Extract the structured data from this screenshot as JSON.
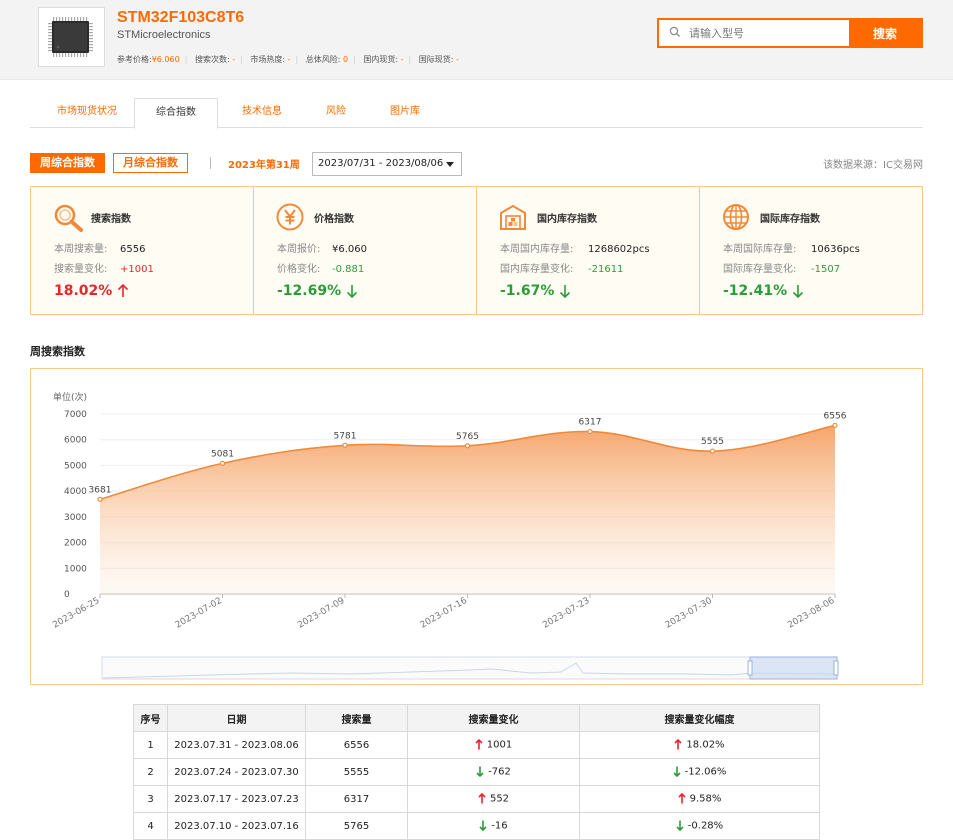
{
  "header": {
    "part_number": "STM32F103C8T6",
    "manufacturer": "STMicroelectronics",
    "metrics": [
      {
        "label": "参考价格:",
        "value": "¥6.060"
      },
      {
        "label": "搜索次数:",
        "value": "-"
      },
      {
        "label": "市场热度:",
        "value": "-"
      },
      {
        "label": "总体风险:",
        "value": "0"
      },
      {
        "label": "国内现货:",
        "value": "-"
      },
      {
        "label": "国际现货:",
        "value": "-"
      }
    ],
    "search_placeholder": "请输入型号",
    "search_button": "搜索"
  },
  "tabs": [
    {
      "label": "市场现货状况",
      "active": false
    },
    {
      "label": "综合指数",
      "active": true
    },
    {
      "label": "技术信息",
      "active": false
    },
    {
      "label": "风险",
      "active": false
    },
    {
      "label": "图片库",
      "active": false
    }
  ],
  "period": {
    "week_button": "周综合指数",
    "month_button": "月综合指数",
    "week_label": "2023年第31周",
    "date_range": "2023/07/31 - 2023/08/06",
    "source": "该数据来源：IC交易网"
  },
  "cards": [
    {
      "icon": "magnifier-icon",
      "title": "搜索指数",
      "row1_label": "本周搜索量:",
      "row1_value": "6556",
      "row2_label": "搜索量变化:",
      "row2_value": "+1001",
      "row2_dir": "up",
      "pct": "18.02%",
      "dir": "up"
    },
    {
      "icon": "yen-icon",
      "title": "价格指数",
      "row1_label": "本周报价:",
      "row1_value": "¥6.060",
      "row2_label": "价格变化:",
      "row2_value": "-0.881",
      "row2_dir": "down",
      "pct": "-12.69%",
      "dir": "down"
    },
    {
      "icon": "warehouse-icon",
      "title": "国内库存指数",
      "row1_label": "本周国内库存量:",
      "row1_value": "1268602pcs",
      "row2_label": "国内库存量变化:",
      "row2_value": "-21611",
      "row2_dir": "down",
      "pct": "-1.67%",
      "dir": "down"
    },
    {
      "icon": "globe-icon",
      "title": "国际库存指数",
      "row1_label": "本周国际库存量:",
      "row1_value": "10636pcs",
      "row2_label": "国际库存量变化:",
      "row2_value": "-1507",
      "row2_dir": "down",
      "pct": "-12.41%",
      "dir": "down"
    }
  ],
  "chart_section_title": "周搜索指数",
  "chart_data": {
    "type": "area",
    "title": "",
    "ylabel": "单位(次)",
    "xlabel": "",
    "x": [
      "2023-06-25",
      "2023-07-02",
      "2023-07-09",
      "2023-07-16",
      "2023-07-23",
      "2023-07-30",
      "2023-08-06"
    ],
    "series": [
      {
        "values": [
          3681,
          5081,
          5781,
          5765,
          6317,
          5555,
          6556
        ]
      }
    ],
    "ylim": [
      0,
      7000
    ],
    "yticks": [
      0,
      1000,
      2000,
      3000,
      4000,
      5000,
      6000,
      7000
    ],
    "grid": true,
    "color": "#f08a3a",
    "data_labels": true
  },
  "table": {
    "headers": [
      "序号",
      "日期",
      "搜索量",
      "搜索量变化",
      "搜索量变化幅度"
    ],
    "rows": [
      {
        "no": "1",
        "date": "2023.07.31 - 2023.08.06",
        "volume": "6556",
        "change": "1001",
        "change_dir": "up",
        "pct": "18.02%",
        "pct_dir": "up"
      },
      {
        "no": "2",
        "date": "2023.07.24 - 2023.07.30",
        "volume": "5555",
        "change": "-762",
        "change_dir": "down",
        "pct": "-12.06%",
        "pct_dir": "down"
      },
      {
        "no": "3",
        "date": "2023.07.17 - 2023.07.23",
        "volume": "6317",
        "change": "552",
        "change_dir": "up",
        "pct": "9.58%",
        "pct_dir": "up"
      },
      {
        "no": "4",
        "date": "2023.07.10 - 2023.07.16",
        "volume": "5765",
        "change": "-16",
        "change_dir": "down",
        "pct": "-0.28%",
        "pct_dir": "down"
      }
    ]
  },
  "colors": {
    "accent": "#ff6a00",
    "up": "#e5262c",
    "down": "#2d9b3a",
    "card_border": "#f5c98a",
    "card_bg": "#fffdf3"
  }
}
